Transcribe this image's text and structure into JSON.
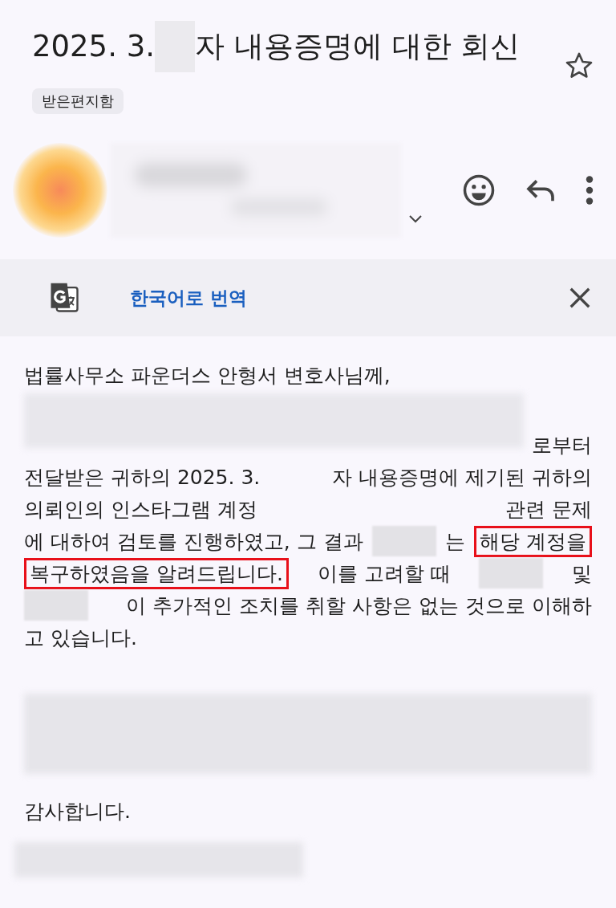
{
  "subject": {
    "segments": [
      {
        "kind": "text",
        "text": "2025. 3."
      },
      {
        "kind": "redacted"
      },
      {
        "kind": "text",
        "text": "자 내용증명에 대한 회신"
      }
    ],
    "starred": false
  },
  "label": "받은편지함",
  "translate_bar": {
    "link": "한국어로 번역"
  },
  "greeting": "법률사무소 파운더스 안형서 변호사님께,",
  "paragraph": [
    [
      {
        "kind": "redacted_line"
      },
      {
        "kind": "text",
        "text": "로부터"
      }
    ],
    [
      {
        "kind": "text",
        "text": "전달받은 귀하의 2025. 3."
      },
      {
        "kind": "text",
        "text": "자 내용증명에 제기된 귀하의"
      }
    ],
    [
      {
        "kind": "text",
        "text": "의뢰인의 인스타그램 계정"
      },
      {
        "kind": "text",
        "text": "관련 문제"
      }
    ],
    [
      {
        "kind": "text",
        "text": "에 대하여 검토를 진행하였고, 그 결과"
      },
      {
        "kind": "redacted"
      },
      {
        "kind": "text",
        "text": "는"
      },
      {
        "kind": "highlight",
        "text": "해당 계정을"
      }
    ],
    [
      {
        "kind": "highlight",
        "text": "복구하였음을 알려드립니다."
      },
      {
        "kind": "text",
        "text": "이를 고려할 때"
      },
      {
        "kind": "redacted"
      },
      {
        "kind": "text",
        "text": "및"
      }
    ],
    [
      {
        "kind": "redacted"
      },
      {
        "kind": "text",
        "text": "이 추가적인 조치를 취할 사항은 없는 것으로 이해하"
      }
    ],
    [
      {
        "kind": "text",
        "text": "고 있습니다."
      }
    ]
  ],
  "closing": "감사합니다."
}
